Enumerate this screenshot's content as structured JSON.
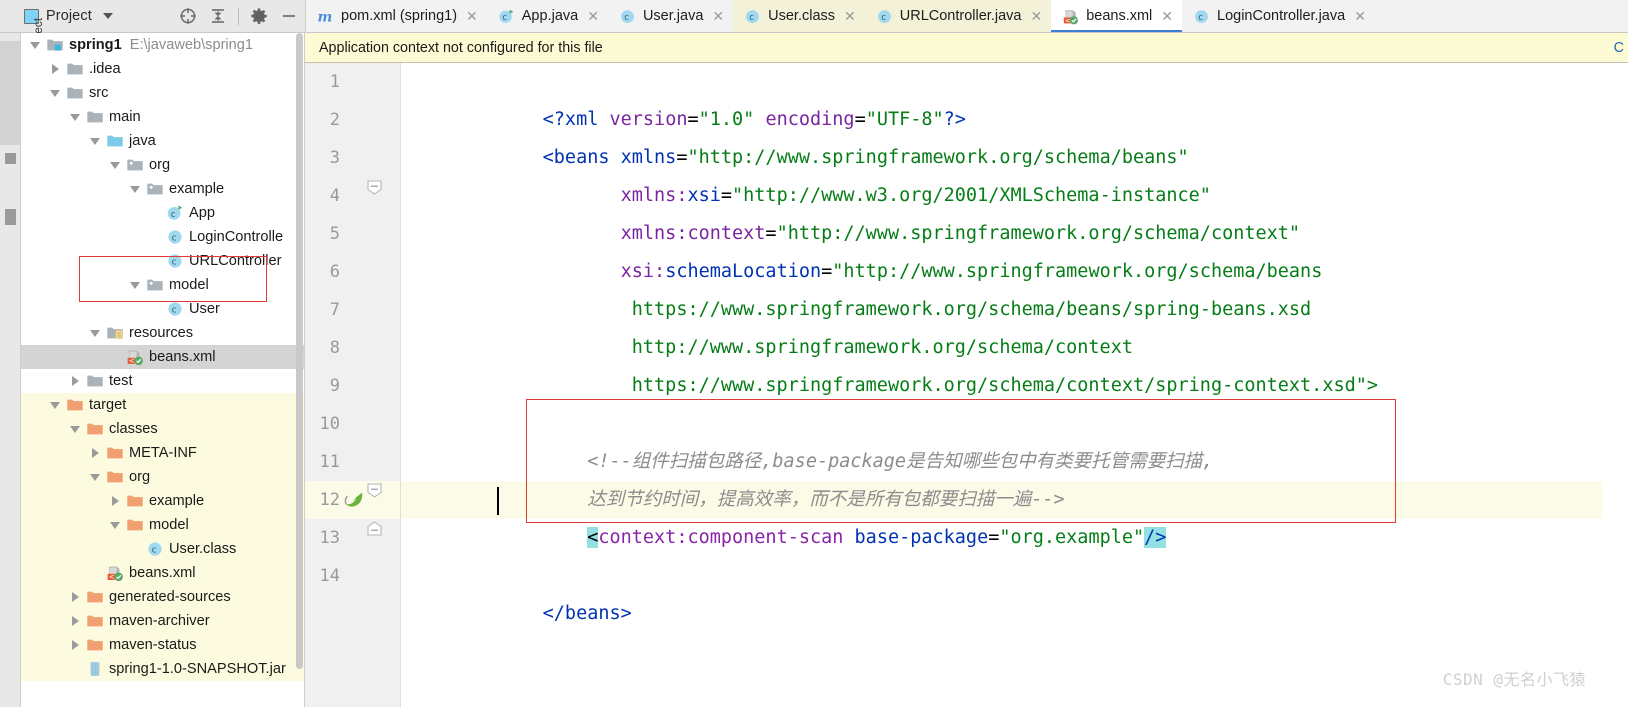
{
  "window": {
    "tool_window_stripe_label": "1: Project"
  },
  "project_panel": {
    "title": "Project",
    "caret_icon": "chevron-down-icon",
    "window_icon": "project-window-icon",
    "toolbar": [
      {
        "name": "select-opened-file-icon",
        "label": "select-opened-file"
      },
      {
        "name": "collapse-all-icon",
        "label": "collapse-all"
      },
      {
        "name": "settings-gear-icon",
        "label": "settings"
      },
      {
        "name": "hide-icon",
        "label": "hide"
      }
    ]
  },
  "tree": {
    "items": [
      {
        "indent": 0,
        "arrow": "down",
        "icon": "module-folder-icon",
        "label": "spring1",
        "bold": true,
        "path": "E:\\javaweb\\spring1",
        "excluded": false,
        "selected": false
      },
      {
        "indent": 1,
        "arrow": "right",
        "icon": "folder-icon",
        "label": ".idea",
        "bold": false,
        "path": "",
        "excluded": false,
        "selected": false
      },
      {
        "indent": 1,
        "arrow": "down",
        "icon": "folder-icon",
        "label": "src",
        "bold": false,
        "path": "",
        "excluded": false,
        "selected": false
      },
      {
        "indent": 2,
        "arrow": "down",
        "icon": "folder-icon",
        "label": "main",
        "bold": false,
        "path": "",
        "excluded": false,
        "selected": false
      },
      {
        "indent": 3,
        "arrow": "down",
        "icon": "source-folder-icon",
        "label": "java",
        "bold": false,
        "path": "",
        "excluded": false,
        "selected": false
      },
      {
        "indent": 4,
        "arrow": "down",
        "icon": "package-icon",
        "label": "org",
        "bold": false,
        "path": "",
        "excluded": false,
        "selected": false
      },
      {
        "indent": 5,
        "arrow": "down",
        "icon": "package-icon",
        "label": "example",
        "bold": false,
        "path": "",
        "excluded": false,
        "selected": false
      },
      {
        "indent": 6,
        "arrow": "none",
        "icon": "java-class-run-icon",
        "label": "App",
        "bold": false,
        "path": "",
        "excluded": false,
        "selected": false
      },
      {
        "indent": 6,
        "arrow": "none",
        "icon": "java-class-icon",
        "label": "LoginControlle",
        "bold": false,
        "path": "",
        "excluded": false,
        "selected": false
      },
      {
        "indent": 6,
        "arrow": "none",
        "icon": "java-class-icon",
        "label": "URLController",
        "bold": false,
        "path": "",
        "excluded": false,
        "selected": false
      },
      {
        "indent": 5,
        "arrow": "down",
        "icon": "package-icon",
        "label": "model",
        "bold": false,
        "path": "",
        "excluded": false,
        "selected": false
      },
      {
        "indent": 6,
        "arrow": "none",
        "icon": "java-class-icon",
        "label": "User",
        "bold": false,
        "path": "",
        "excluded": false,
        "selected": false
      },
      {
        "indent": 3,
        "arrow": "down",
        "icon": "resource-folder-icon",
        "label": "resources",
        "bold": false,
        "path": "",
        "excluded": false,
        "selected": false
      },
      {
        "indent": 4,
        "arrow": "none",
        "icon": "spring-xml-icon",
        "label": "beans.xml",
        "bold": false,
        "path": "",
        "excluded": false,
        "selected": true
      },
      {
        "indent": 2,
        "arrow": "right",
        "icon": "folder-icon",
        "label": "test",
        "bold": false,
        "path": "",
        "excluded": false,
        "selected": false
      },
      {
        "indent": 1,
        "arrow": "down",
        "icon": "excluded-folder-icon",
        "label": "target",
        "bold": false,
        "path": "",
        "excluded": true,
        "selected": false
      },
      {
        "indent": 2,
        "arrow": "down",
        "icon": "excluded-folder-icon",
        "label": "classes",
        "bold": false,
        "path": "",
        "excluded": true,
        "selected": false
      },
      {
        "indent": 3,
        "arrow": "right",
        "icon": "excluded-folder-icon",
        "label": "META-INF",
        "bold": false,
        "path": "",
        "excluded": true,
        "selected": false
      },
      {
        "indent": 3,
        "arrow": "down",
        "icon": "excluded-folder-icon",
        "label": "org",
        "bold": false,
        "path": "",
        "excluded": true,
        "selected": false
      },
      {
        "indent": 4,
        "arrow": "right",
        "icon": "excluded-folder-icon",
        "label": "example",
        "bold": false,
        "path": "",
        "excluded": true,
        "selected": false
      },
      {
        "indent": 4,
        "arrow": "down",
        "icon": "excluded-folder-icon",
        "label": "model",
        "bold": false,
        "path": "",
        "excluded": true,
        "selected": false
      },
      {
        "indent": 5,
        "arrow": "none",
        "icon": "java-class-icon",
        "label": "User.class",
        "bold": false,
        "path": "",
        "excluded": true,
        "selected": false
      },
      {
        "indent": 3,
        "arrow": "none",
        "icon": "spring-xml-icon",
        "label": "beans.xml",
        "bold": false,
        "path": "",
        "excluded": true,
        "selected": false
      },
      {
        "indent": 2,
        "arrow": "right",
        "icon": "excluded-folder-icon",
        "label": "generated-sources",
        "bold": false,
        "path": "",
        "excluded": true,
        "selected": false
      },
      {
        "indent": 2,
        "arrow": "right",
        "icon": "excluded-folder-icon",
        "label": "maven-archiver",
        "bold": false,
        "path": "",
        "excluded": true,
        "selected": false
      },
      {
        "indent": 2,
        "arrow": "right",
        "icon": "excluded-folder-icon",
        "label": "maven-status",
        "bold": false,
        "path": "",
        "excluded": true,
        "selected": false
      },
      {
        "indent": 2,
        "arrow": "none",
        "icon": "jar-icon",
        "label": "spring1-1.0-SNAPSHOT.jar",
        "bold": false,
        "path": "",
        "excluded": true,
        "selected": false
      }
    ]
  },
  "tabs": [
    {
      "label": "pom.xml (spring1)",
      "icon": "maven-icon",
      "state": "normal",
      "close_icon": "close-icon"
    },
    {
      "label": "App.java",
      "icon": "java-run-icon",
      "state": "normal",
      "close_icon": "close-icon"
    },
    {
      "label": "User.java",
      "icon": "java-class-icon",
      "state": "normal",
      "close_icon": "close-icon"
    },
    {
      "label": "User.class",
      "icon": "java-class-icon",
      "state": "highlight",
      "close_icon": "close-icon"
    },
    {
      "label": "URLController.java",
      "icon": "java-class-icon",
      "state": "normal",
      "close_icon": "close-icon"
    },
    {
      "label": "beans.xml",
      "icon": "spring-xml-icon",
      "state": "active",
      "close_icon": "close-icon"
    },
    {
      "label": "LoginController.java",
      "icon": "java-class-icon",
      "state": "normal",
      "close_icon": "close-icon"
    }
  ],
  "notification": {
    "message": "Application context not configured for this file",
    "action_label": "C"
  },
  "editor": {
    "line_numbers": [
      "1",
      "2",
      "3",
      "4",
      "5",
      "6",
      "7",
      "8",
      "9",
      "10",
      "11",
      "12",
      "13",
      "14"
    ],
    "lines": [
      "<?xml version=\"1.0\" encoding=\"UTF-8\"?>",
      "<beans xmlns=\"http://www.springframework.org/schema/beans\"",
      "       xmlns:xsi=\"http://www.w3.org/2001/XMLSchema-instance\"",
      "       xmlns:context=\"http://www.springframework.org/schema/context\"",
      "       xsi:schemaLocation=\"http://www.springframework.org/schema/beans",
      "        https://www.springframework.org/schema/beans/spring-beans.xsd",
      "        http://www.springframework.org/schema/context",
      "        https://www.springframework.org/schema/context/spring-context.xsd\">",
      "",
      "    <!--组件扫描包路径,base-package是告知哪些包中有类要托管需要扫描,",
      "    达到节约时间，提高效率，而不是所有包都要扫描一遍-->",
      "    <context:component-scan base-package=\"org.example\"/>",
      "",
      "</beans>"
    ],
    "tokens": {
      "l1": {
        "open": "<?xml",
        "attr1": "version",
        "val1": "\"1.0\"",
        "attr2": "encoding",
        "val2": "\"UTF-8\"",
        "close": "?>"
      },
      "l2": {
        "open": "<beans",
        "attr": "xmlns",
        "val": "\"http://www.springframework.org/schema/beans\""
      },
      "l3": {
        "ns": "xmlns:",
        "attr": "xsi",
        "val": "\"http://www.w3.org/2001/XMLSchema-instance\""
      },
      "l4": {
        "ns": "xmlns:",
        "attr": "context",
        "val": "\"http://www.springframework.org/schema/context\""
      },
      "l5": {
        "ns": "xsi:",
        "attr": "schemaLocation",
        "val": "\"http://www.springframework.org/schema/beans"
      },
      "l6": {
        "val": "https://www.springframework.org/schema/beans/spring-beans.xsd"
      },
      "l7": {
        "val": "http://www.springframework.org/schema/context"
      },
      "l8": {
        "val": "https://www.springframework.org/schema/context/spring-context.xsd\">"
      },
      "l10": {
        "comment": "<!--组件扫描包路径,base-package是告知哪些包中有类要托管需要扫描,"
      },
      "l11": {
        "comment": "达到节约时间，提高效率，而不是所有包都要扫描一遍-->"
      },
      "l12": {
        "lt": "<",
        "tag": "context:component-scan",
        "attr": "base-package",
        "eq": "=",
        "val": "\"org.example\"",
        "selfclose": "/>"
      },
      "l14": {
        "close": "</beans>"
      }
    },
    "bean_gutter_icon": "spring-bean-icon",
    "fold_lines": [
      "2",
      "10",
      "11"
    ],
    "highlighted_line": "12"
  },
  "watermark": {
    "text": "CSDN @无名小飞猿"
  },
  "colors": {
    "tag": "#0033b3",
    "attribute": "#7b25a3",
    "value": "#067d17",
    "comment": "#8c8c8c",
    "bracket_match": "#93e0e3",
    "notification_bg": "#fdfbd3",
    "excluded_bg": "#fcfbe0",
    "selection_bg": "#d4d4d4",
    "highlight_box": "#e03b3b",
    "active_tab_underline": "#3d7fd4"
  }
}
